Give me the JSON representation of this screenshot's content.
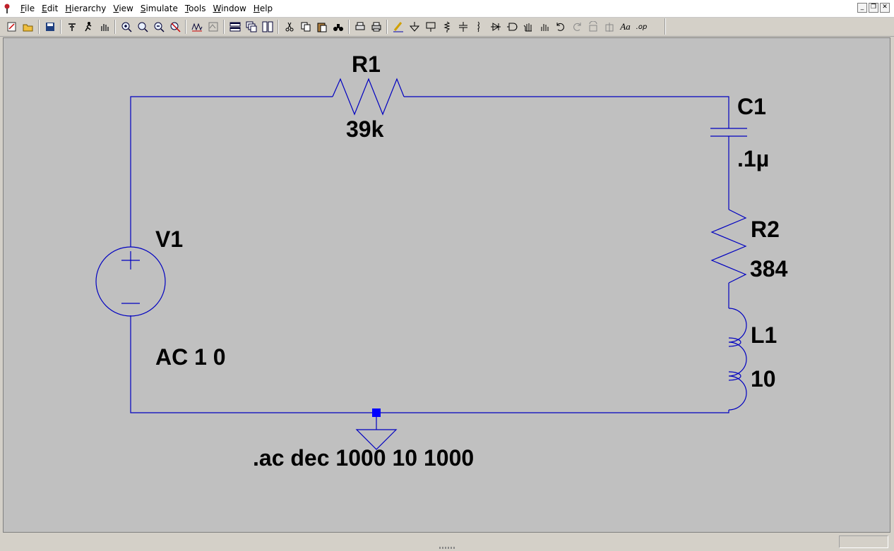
{
  "menu": {
    "items": [
      "File",
      "Edit",
      "Hierarchy",
      "View",
      "Simulate",
      "Tools",
      "Window",
      "Help"
    ]
  },
  "window_controls": [
    "minimize",
    "restore",
    "close"
  ],
  "toolbar": {
    "groups": [
      [
        "new-schematic-icon",
        "open-icon"
      ],
      [
        "save-icon"
      ],
      [
        "control-panel-icon",
        "run-icon",
        "pan-icon"
      ],
      [
        "zoom-in-icon",
        "zoom-to-fit-icon",
        "zoom-out-icon",
        "cancel-zoom-icon"
      ],
      [
        "waveform-icon",
        "autoscale-icon"
      ],
      [
        "tile-horizontal-icon",
        "cascade-icon",
        "tile-windows-icon"
      ],
      [
        "cut-icon",
        "copy-icon",
        "paste-icon",
        "find-icon"
      ],
      [
        "print-preview-icon",
        "print-icon"
      ],
      [
        "draw-wire-icon",
        "ground-icon",
        "label-net-icon",
        "resistor-icon",
        "capacitor-icon",
        "inductor-icon",
        "diode-icon",
        "component-icon",
        "move-icon",
        "drag-icon",
        "undo-icon",
        "redo-icon",
        "rotate-icon",
        "mirror-icon",
        "text-icon",
        "spice-directive-icon"
      ]
    ],
    "text_label": "Aa",
    "op_label": ".op"
  },
  "schematic": {
    "wire_color": "#0000c0",
    "junction_color": "#0000ff",
    "background": "#c0c0c0",
    "components": {
      "r1": {
        "name": "R1",
        "value": "39k"
      },
      "c1": {
        "name": "C1",
        "value": ".1µ"
      },
      "r2": {
        "name": "R2",
        "value": "384"
      },
      "l1": {
        "name": "L1",
        "value": "10"
      },
      "v1": {
        "name": "V1",
        "value": "AC 1 0"
      }
    },
    "directive": ".ac dec 1000 10 1000"
  }
}
